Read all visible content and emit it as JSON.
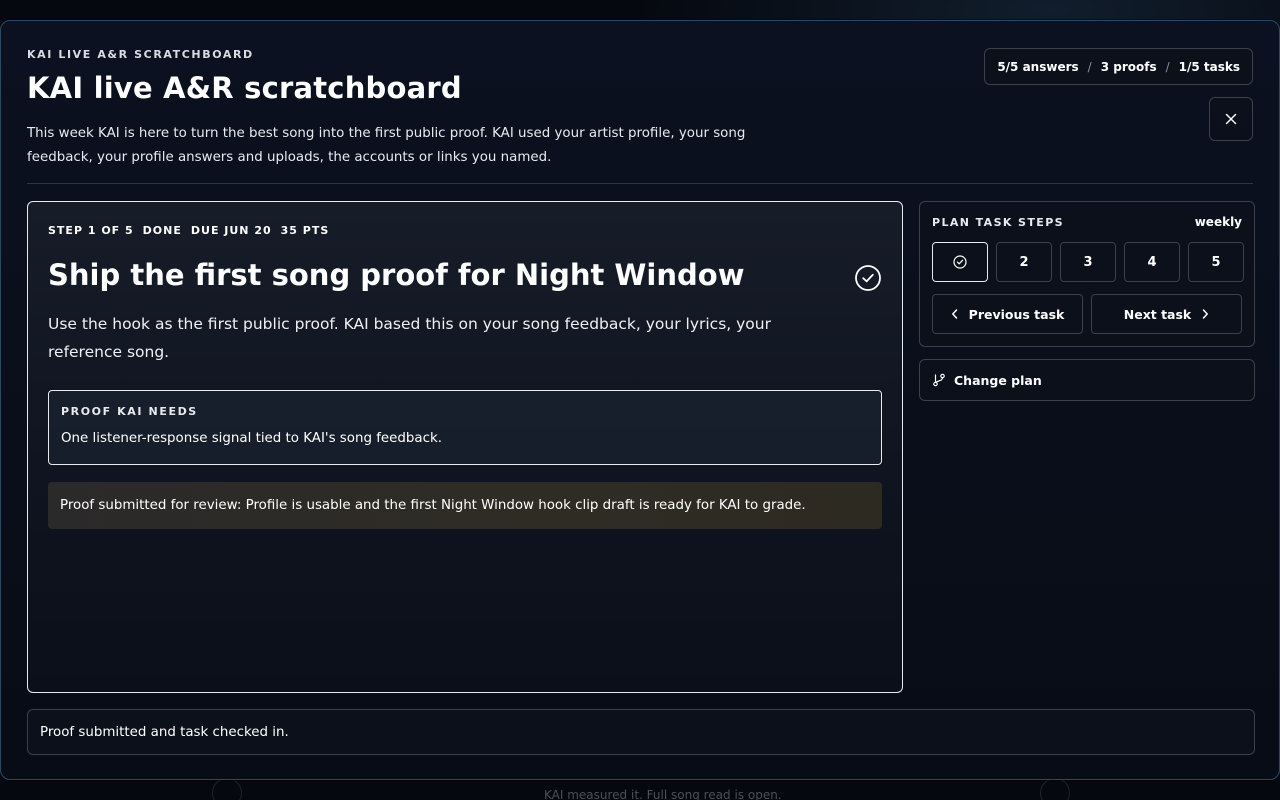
{
  "background": {
    "hint_text": "KAI measured it. Full song read is open."
  },
  "header": {
    "eyebrow": "KAI LIVE A&R SCRATCHBOARD",
    "title": "KAI live A&R scratchboard",
    "intro": "This week KAI is here to turn the best song into the first public proof. KAI used your artist profile, your song feedback, your profile answers and uploads, the accounts or links you named.",
    "stats": {
      "answers": "5/5 answers",
      "proofs": "3 proofs",
      "tasks": "1/5 tasks",
      "separator": "/"
    },
    "close_icon": "close-icon"
  },
  "task": {
    "meta": {
      "step": "STEP 1 OF 5",
      "status": "DONE",
      "due": "DUE JUN 20",
      "points": "35 PTS"
    },
    "title": "Ship the first song proof for Night Window",
    "status_icon": "check-circle-icon",
    "description": "Use the hook as the first public proof. KAI based this on your song feedback, your lyrics, your reference song.",
    "proof_label": "PROOF KAI NEEDS",
    "proof_text": "One listener-response signal tied to KAI's song feedback.",
    "submitted_text": "Proof submitted for review: Profile is usable and the first Night Window hook clip draft is ready for KAI to grade."
  },
  "plan": {
    "label": "PLAN TASK STEPS",
    "cadence": "weekly",
    "steps": [
      {
        "label": "",
        "icon": "check-circle-icon",
        "active": true
      },
      {
        "label": "2"
      },
      {
        "label": "3"
      },
      {
        "label": "4"
      },
      {
        "label": "5"
      }
    ],
    "previous_label": "Previous task",
    "next_label": "Next task",
    "change_plan_label": "Change plan"
  },
  "footer": {
    "status_text": "Proof submitted and task checked in."
  }
}
